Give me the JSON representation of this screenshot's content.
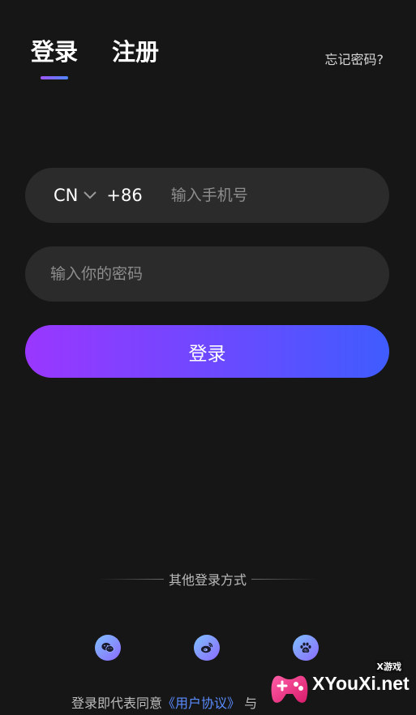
{
  "tabs": [
    {
      "label": "登录",
      "active": true
    },
    {
      "label": "注册",
      "active": false
    }
  ],
  "forgot_password": "忘记密码?",
  "phone": {
    "country_code": "CN",
    "dial_code": "+86",
    "placeholder": "输入手机号",
    "value": ""
  },
  "password": {
    "placeholder": "输入你的密码",
    "value": ""
  },
  "login_button": "登录",
  "other_methods_label": "其他登录方式",
  "social": [
    {
      "name": "wechat-icon"
    },
    {
      "name": "weibo-icon"
    },
    {
      "name": "baidu-icon"
    }
  ],
  "agreement": {
    "prefix": "登录即代表同意",
    "user_agreement": "《用户协议》",
    "connector": "与"
  },
  "watermark": {
    "small_text": "X游戏",
    "site": "XYouXi.net"
  },
  "colors": {
    "background": "#161616",
    "field": "#2b2b2b",
    "gradient_start": "#9a37ff",
    "gradient_end": "#3f5cff",
    "link": "#5a8cff"
  }
}
